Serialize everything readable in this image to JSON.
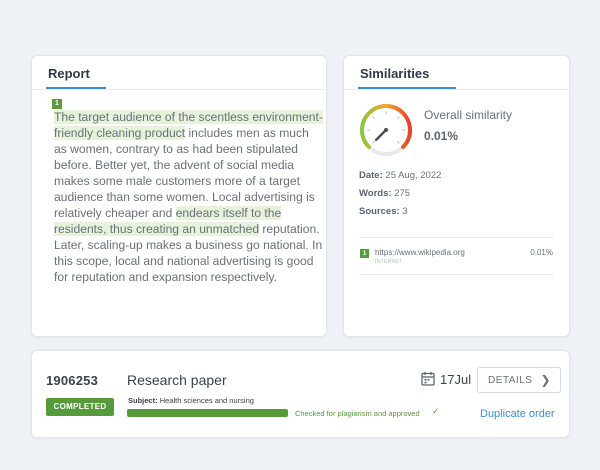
{
  "report": {
    "title": "Report",
    "paragraph_number": "1",
    "segments": [
      {
        "text": "The target audience of the scentless environment-friendly cleaning product",
        "highlight": true
      },
      {
        "text": " includes men as much as women, contrary to as had been stipulated before. Better yet, the advent of social media makes some male customers more of a target audience than some women. Local advertising is relatively cheaper and ",
        "highlight": false
      },
      {
        "text": "endears itself to the residents, thus creating an unmatched",
        "highlight": true
      },
      {
        "text": " reputation. Later, scaling-up makes a business go national. In this scope, local and national advertising is good for reputation and expansion respectively.",
        "highlight": false
      }
    ]
  },
  "similarities": {
    "title": "Similarities",
    "overall_label": "Overall similarity",
    "overall_value": "0.01%",
    "gauge_fraction": 0.0001,
    "date_label": "Date:",
    "date_value": "25 Aug, 2022",
    "words_label": "Words:",
    "words_value": "275",
    "sources_label": "Sources:",
    "sources_value": "3",
    "source": {
      "number": "1",
      "url": "https://www.wikipedia.org",
      "sub": "INTERNET",
      "percent": "0.01%"
    }
  },
  "order": {
    "id": "1906253",
    "status": "COMPLETED",
    "type": "Research paper",
    "subject_label": "Subject:",
    "subject_value": "Health sciences and nursing",
    "progress_fraction": 1.0,
    "progress_note": "Checked for plagiarism and approved",
    "due_date": "17Jul",
    "details_label": "DETAILS",
    "duplicate_label": "Duplicate order"
  },
  "colors": {
    "accent_blue": "#3b8fd0",
    "success_green": "#569a3c",
    "highlight_green": "#e6f3da",
    "gauge_start": "#8cc63f",
    "gauge_mid": "#f5a623",
    "gauge_end": "#e8412c"
  },
  "icons": {
    "calendar": "calendar-icon",
    "chevron": "chevron-right-icon",
    "check": "check-icon",
    "gauge": "similarity-gauge"
  }
}
